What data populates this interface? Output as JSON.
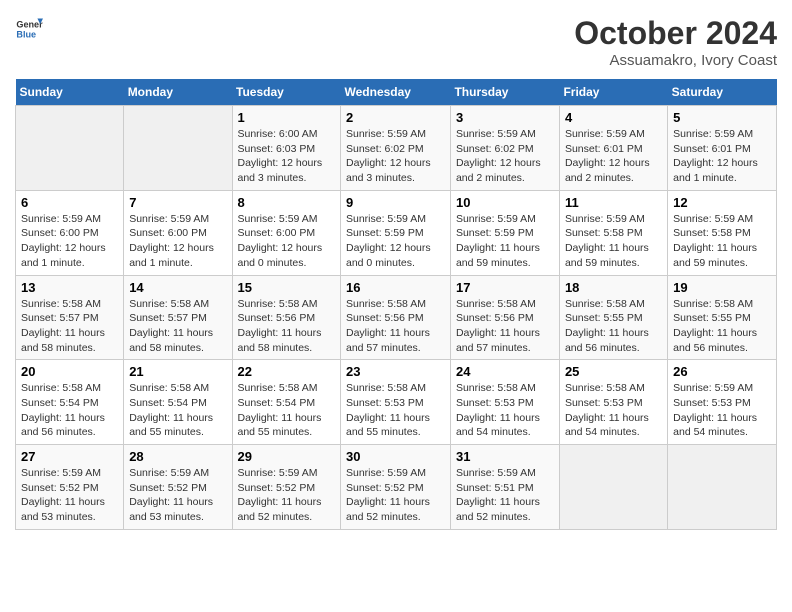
{
  "logo": {
    "line1": "General",
    "line2": "Blue"
  },
  "title": "October 2024",
  "subtitle": "Assuamakro, Ivory Coast",
  "header_days": [
    "Sunday",
    "Monday",
    "Tuesday",
    "Wednesday",
    "Thursday",
    "Friday",
    "Saturday"
  ],
  "weeks": [
    [
      {
        "day": "",
        "info": ""
      },
      {
        "day": "",
        "info": ""
      },
      {
        "day": "1",
        "info": "Sunrise: 6:00 AM\nSunset: 6:03 PM\nDaylight: 12 hours\nand 3 minutes."
      },
      {
        "day": "2",
        "info": "Sunrise: 5:59 AM\nSunset: 6:02 PM\nDaylight: 12 hours\nand 3 minutes."
      },
      {
        "day": "3",
        "info": "Sunrise: 5:59 AM\nSunset: 6:02 PM\nDaylight: 12 hours\nand 2 minutes."
      },
      {
        "day": "4",
        "info": "Sunrise: 5:59 AM\nSunset: 6:01 PM\nDaylight: 12 hours\nand 2 minutes."
      },
      {
        "day": "5",
        "info": "Sunrise: 5:59 AM\nSunset: 6:01 PM\nDaylight: 12 hours\nand 1 minute."
      }
    ],
    [
      {
        "day": "6",
        "info": "Sunrise: 5:59 AM\nSunset: 6:00 PM\nDaylight: 12 hours\nand 1 minute."
      },
      {
        "day": "7",
        "info": "Sunrise: 5:59 AM\nSunset: 6:00 PM\nDaylight: 12 hours\nand 1 minute."
      },
      {
        "day": "8",
        "info": "Sunrise: 5:59 AM\nSunset: 6:00 PM\nDaylight: 12 hours\nand 0 minutes."
      },
      {
        "day": "9",
        "info": "Sunrise: 5:59 AM\nSunset: 5:59 PM\nDaylight: 12 hours\nand 0 minutes."
      },
      {
        "day": "10",
        "info": "Sunrise: 5:59 AM\nSunset: 5:59 PM\nDaylight: 11 hours\nand 59 minutes."
      },
      {
        "day": "11",
        "info": "Sunrise: 5:59 AM\nSunset: 5:58 PM\nDaylight: 11 hours\nand 59 minutes."
      },
      {
        "day": "12",
        "info": "Sunrise: 5:59 AM\nSunset: 5:58 PM\nDaylight: 11 hours\nand 59 minutes."
      }
    ],
    [
      {
        "day": "13",
        "info": "Sunrise: 5:58 AM\nSunset: 5:57 PM\nDaylight: 11 hours\nand 58 minutes."
      },
      {
        "day": "14",
        "info": "Sunrise: 5:58 AM\nSunset: 5:57 PM\nDaylight: 11 hours\nand 58 minutes."
      },
      {
        "day": "15",
        "info": "Sunrise: 5:58 AM\nSunset: 5:56 PM\nDaylight: 11 hours\nand 58 minutes."
      },
      {
        "day": "16",
        "info": "Sunrise: 5:58 AM\nSunset: 5:56 PM\nDaylight: 11 hours\nand 57 minutes."
      },
      {
        "day": "17",
        "info": "Sunrise: 5:58 AM\nSunset: 5:56 PM\nDaylight: 11 hours\nand 57 minutes."
      },
      {
        "day": "18",
        "info": "Sunrise: 5:58 AM\nSunset: 5:55 PM\nDaylight: 11 hours\nand 56 minutes."
      },
      {
        "day": "19",
        "info": "Sunrise: 5:58 AM\nSunset: 5:55 PM\nDaylight: 11 hours\nand 56 minutes."
      }
    ],
    [
      {
        "day": "20",
        "info": "Sunrise: 5:58 AM\nSunset: 5:54 PM\nDaylight: 11 hours\nand 56 minutes."
      },
      {
        "day": "21",
        "info": "Sunrise: 5:58 AM\nSunset: 5:54 PM\nDaylight: 11 hours\nand 55 minutes."
      },
      {
        "day": "22",
        "info": "Sunrise: 5:58 AM\nSunset: 5:54 PM\nDaylight: 11 hours\nand 55 minutes."
      },
      {
        "day": "23",
        "info": "Sunrise: 5:58 AM\nSunset: 5:53 PM\nDaylight: 11 hours\nand 55 minutes."
      },
      {
        "day": "24",
        "info": "Sunrise: 5:58 AM\nSunset: 5:53 PM\nDaylight: 11 hours\nand 54 minutes."
      },
      {
        "day": "25",
        "info": "Sunrise: 5:58 AM\nSunset: 5:53 PM\nDaylight: 11 hours\nand 54 minutes."
      },
      {
        "day": "26",
        "info": "Sunrise: 5:59 AM\nSunset: 5:53 PM\nDaylight: 11 hours\nand 54 minutes."
      }
    ],
    [
      {
        "day": "27",
        "info": "Sunrise: 5:59 AM\nSunset: 5:52 PM\nDaylight: 11 hours\nand 53 minutes."
      },
      {
        "day": "28",
        "info": "Sunrise: 5:59 AM\nSunset: 5:52 PM\nDaylight: 11 hours\nand 53 minutes."
      },
      {
        "day": "29",
        "info": "Sunrise: 5:59 AM\nSunset: 5:52 PM\nDaylight: 11 hours\nand 52 minutes."
      },
      {
        "day": "30",
        "info": "Sunrise: 5:59 AM\nSunset: 5:52 PM\nDaylight: 11 hours\nand 52 minutes."
      },
      {
        "day": "31",
        "info": "Sunrise: 5:59 AM\nSunset: 5:51 PM\nDaylight: 11 hours\nand 52 minutes."
      },
      {
        "day": "",
        "info": ""
      },
      {
        "day": "",
        "info": ""
      }
    ]
  ]
}
